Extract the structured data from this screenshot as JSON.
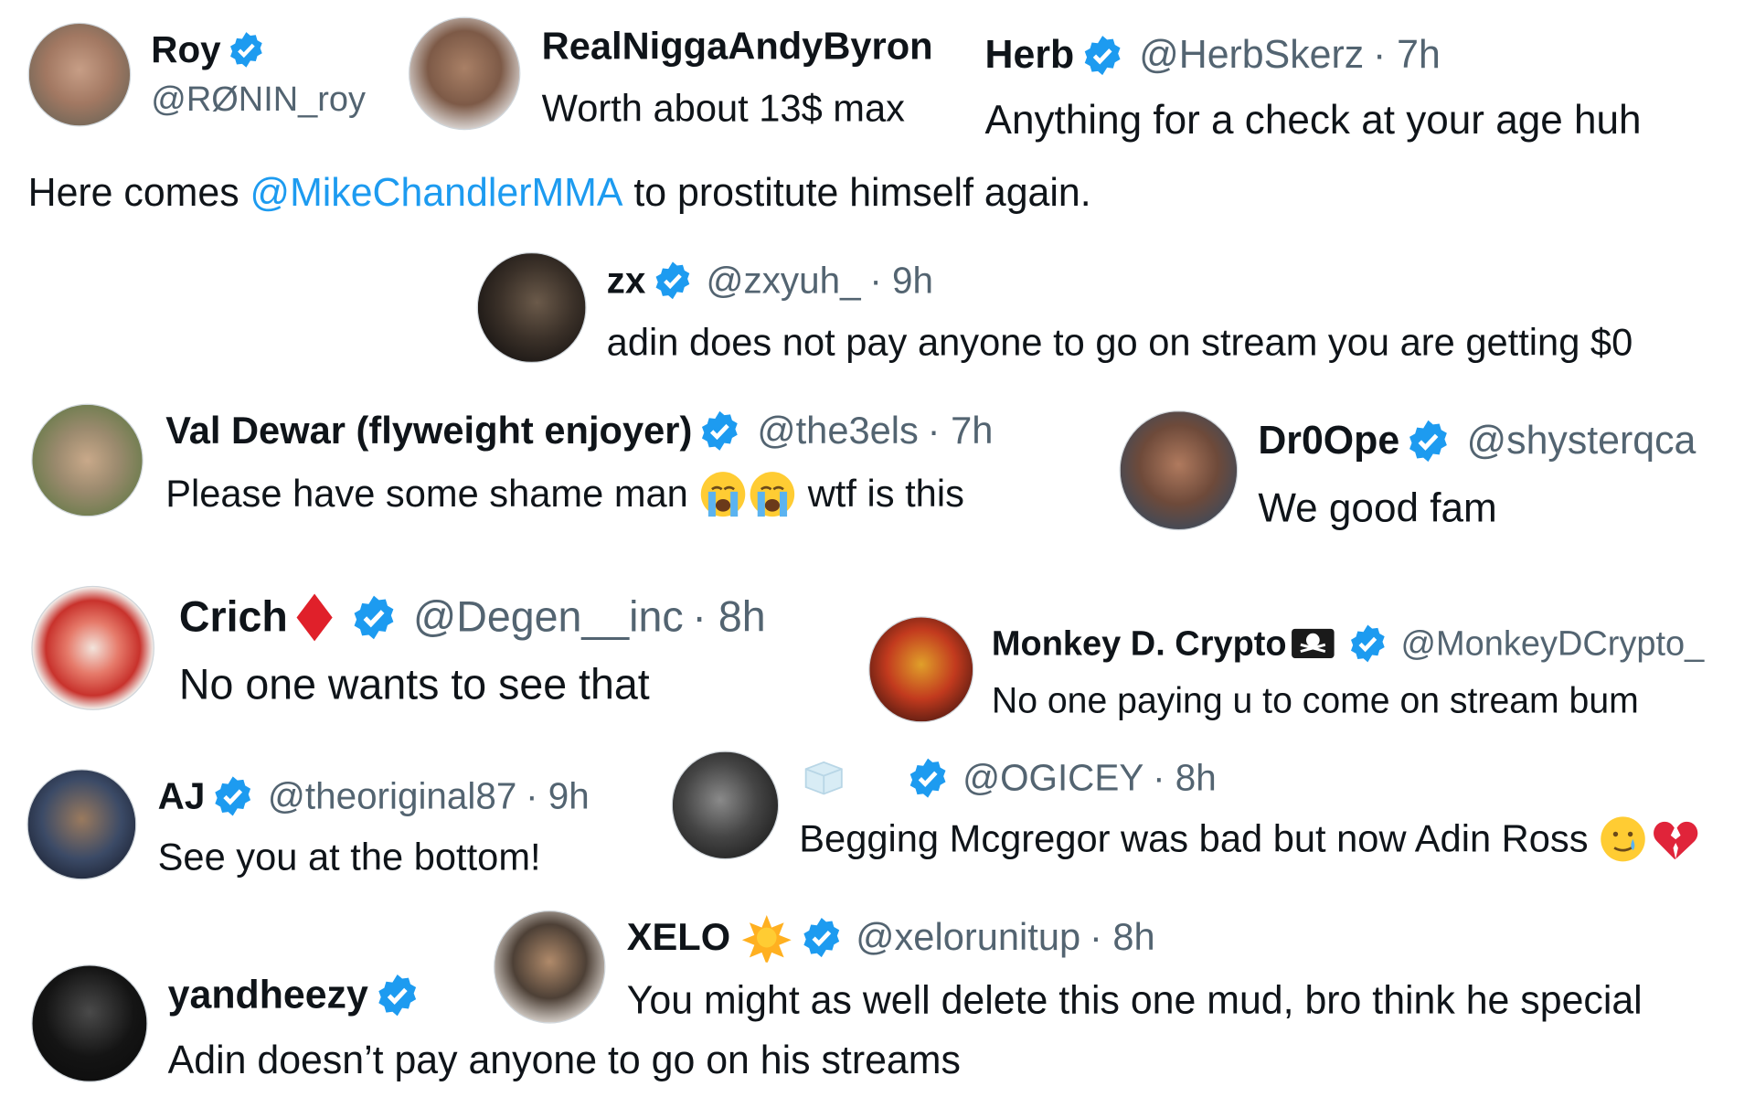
{
  "posts": [
    {
      "name": "Roy",
      "handle": "@RØNIN_roy",
      "time": "",
      "text": "Here comes ",
      "mention": "@MikeChandlerMMA",
      "text_after": " to prostitute himself again.",
      "avatar_color": "#8a6b5a"
    },
    {
      "name": "RealNiggaAndyByron",
      "handle": "",
      "time": "",
      "text": "Worth about 13$ max",
      "avatar_color": "#6b5446"
    },
    {
      "name": "Herb",
      "handle": "@HerbSkerz",
      "time": "· 7h",
      "text": "Anything for a check at your age huh"
    },
    {
      "name": "zx",
      "handle": "@zxyuh_",
      "time": "· 9h",
      "text": "adin does not pay anyone to go on stream you are getting $0",
      "avatar_color": "#3a3028"
    },
    {
      "name": "Val Dewar (flyweight enjoyer)",
      "handle": "@the3els",
      "time": "· 7h",
      "text_before": "Please have some shame man ",
      "text_after": " wtf is this",
      "emoji": "crying-face",
      "avatar_color": "#9b8a6e"
    },
    {
      "name": "Dr0Ope",
      "handle": "@shysterqca",
      "time": "",
      "text": "We good fam",
      "avatar_color": "#6e4a3a"
    },
    {
      "name": "Crich",
      "name_suffix_icon": "red-diamond",
      "handle": "@Degen__inc",
      "time": "· 8h",
      "text": "No one wants to see that",
      "avatar_color": "#c8322c"
    },
    {
      "name": "Monkey D. Crypto",
      "name_suffix_icon": "pirate-flag",
      "handle": "@MonkeyDCrypto_",
      "time": "",
      "text": "No one paying u to come on stream bum",
      "avatar_color": "#c23a1e"
    },
    {
      "name": "AJ",
      "handle": "@theoriginal87",
      "time": "· 9h",
      "text": "See you at the bottom!",
      "avatar_color": "#3b4a66"
    },
    {
      "name": "",
      "name_icon": "ice-cube",
      "handle": "@OGICEY",
      "time": "· 8h",
      "text": "Begging Mcgregor was bad but now Adin Ross ",
      "emoji": [
        "crying-smile",
        "broken-heart"
      ],
      "avatar_color": "#454545"
    },
    {
      "name": "XELO",
      "name_suffix_icon": "sun",
      "handle": "@xelorunitup",
      "time": "· 8h",
      "text": "You might as well delete this one mud, bro think he special",
      "avatar_color": "#4d4036"
    },
    {
      "name": "yandheezy",
      "handle": "",
      "time": "",
      "text": "Adin doesn’t pay anyone to go on his streams",
      "avatar_color": "#141414"
    }
  ],
  "colors": {
    "verified": "#1d9bf0",
    "mention": "#1d9bf0",
    "handle": "#536471",
    "text": "#0f1419"
  }
}
